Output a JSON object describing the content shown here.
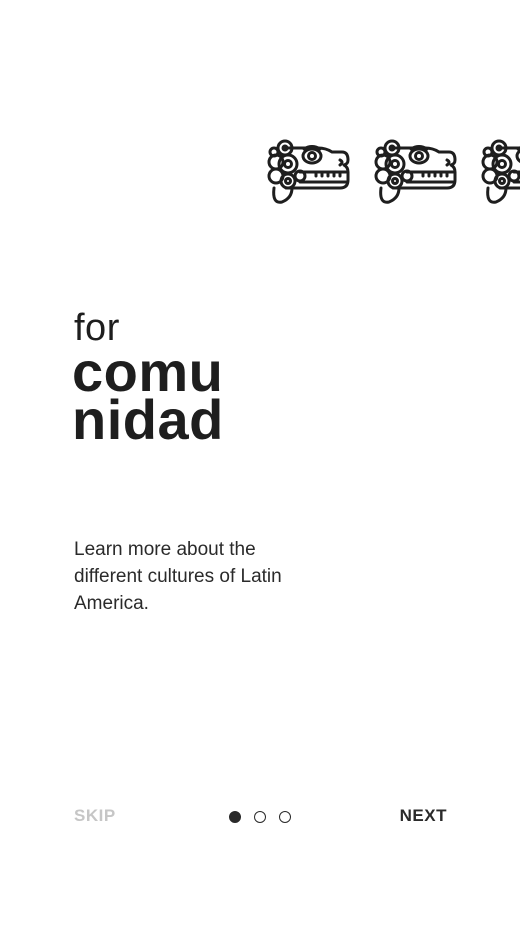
{
  "illustration": {
    "icon_name": "aztec-serpent-head-icon",
    "count_visible": 3
  },
  "heading": {
    "prefix": "for",
    "line1": "comu",
    "line2": "nidad"
  },
  "description": "Learn more about the different cultures of Latin America.",
  "footer": {
    "skip_label": "SKIP",
    "next_label": "NEXT",
    "pager": {
      "total": 3,
      "current": 1
    }
  },
  "colors": {
    "text": "#1e1e1e",
    "skip": "#c6c6c6",
    "background": "#ffffff"
  }
}
